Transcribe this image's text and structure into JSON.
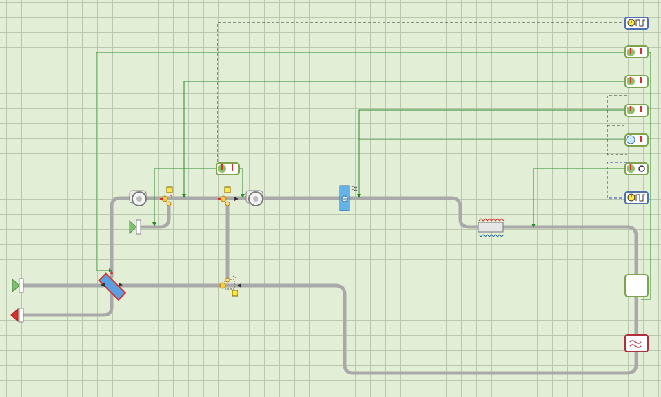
{
  "diagram": {
    "colors": {
      "background": "#e2eed5",
      "grid": "#b9c8ad",
      "duct": "#a9a9a9",
      "signal_line": "#2a8a2a",
      "control_dashed": "#303030",
      "blue_dashed": "#2040c0",
      "sensor_border": "#7da34f",
      "supply_arrow": "#7cc070",
      "exhaust_arrow": "#d93030"
    },
    "components": [
      {
        "id": "outdoor-air-inlet",
        "icon": "green-triangle-inlet"
      },
      {
        "id": "exhaust-air-outlet",
        "icon": "red-triangle-outlet"
      },
      {
        "id": "recirculation-inlet",
        "icon": "green-triangle-inlet"
      },
      {
        "id": "heat-recovery-exchanger",
        "icon": "plate-heat-exchanger"
      },
      {
        "id": "supply-fan-1",
        "icon": "fan"
      },
      {
        "id": "supply-fan-2",
        "icon": "fan"
      },
      {
        "id": "mixing-damper-1",
        "icon": "damper"
      },
      {
        "id": "mixing-damper-2",
        "icon": "damper"
      },
      {
        "id": "return-damper",
        "icon": "damper"
      },
      {
        "id": "humidifier",
        "icon": "humidifier"
      },
      {
        "id": "heating-coil",
        "icon": "heating-coil"
      },
      {
        "id": "zone",
        "icon": "room"
      },
      {
        "id": "radiator",
        "icon": "radiator"
      }
    ],
    "controllers": [
      {
        "id": "schedule-controller-top",
        "icon": "clock-pulse"
      },
      {
        "id": "temperature-controller-1",
        "icon": "thermometer-pair"
      },
      {
        "id": "temperature-controller-2",
        "icon": "thermometer-pair"
      },
      {
        "id": "temperature-controller-3",
        "icon": "thermometer-pair"
      },
      {
        "id": "humidity-controller",
        "icon": "humidity-thermometer"
      },
      {
        "id": "fan-controller",
        "icon": "thermometer-fan"
      },
      {
        "id": "schedule-controller-bottom",
        "icon": "clock-pulse"
      },
      {
        "id": "mixing-controller",
        "icon": "thermometer-pair"
      }
    ]
  }
}
